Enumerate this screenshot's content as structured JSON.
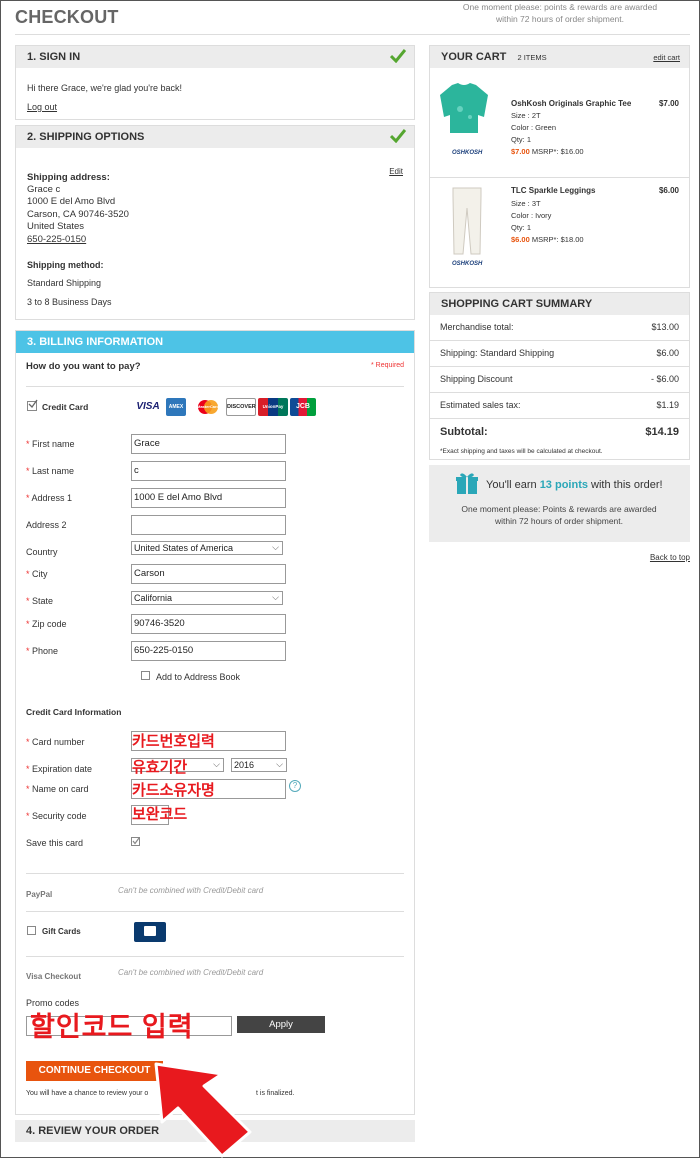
{
  "page": {
    "title": "CHECKOUT",
    "top_note": "One moment please: points & rewards are awarded within 72 hours of order shipment."
  },
  "signin": {
    "heading": "1. SIGN IN",
    "greeting": "Hi there Grace, we're glad you're back!",
    "logout": "Log out"
  },
  "shipping": {
    "heading": "2. SHIPPING OPTIONS",
    "edit": "Edit",
    "address_label": "Shipping address:",
    "name": "Grace c",
    "street": "1000 E del Amo Blvd",
    "city_line": "Carson, CA 90746-3520",
    "country": "United States",
    "phone": "650-225-0150",
    "method_label": "Shipping method:",
    "method": "Standard Shipping",
    "eta": "3 to 8 Business Days"
  },
  "billing": {
    "heading": "3. BILLING INFORMATION",
    "question": "How do you want to pay?",
    "required": "* Required",
    "credit_card_label": "Credit Card",
    "card_logos": [
      "VISA",
      "AMEX",
      "MasterCard",
      "DISCOVER",
      "UnionPay",
      "JCB"
    ],
    "fields": {
      "first_name_label": "First name",
      "first_name_value": "Grace",
      "last_name_label": "Last name",
      "last_name_value": "c",
      "address1_label": "Address 1",
      "address1_value": "1000 E del Amo Blvd",
      "address2_label": "Address 2",
      "address2_value": "",
      "country_label": "Country",
      "country_value": "United States of America",
      "city_label": "City",
      "city_value": "Carson",
      "state_label": "State",
      "state_value": "California",
      "zip_label": "Zip code",
      "zip_value": "90746-3520",
      "phone_label": "Phone",
      "phone_value": "650-225-0150"
    },
    "add_to_address_book": "Add to Address Book",
    "cc_info_heading": "Credit Card Information",
    "card_number_label": "Card number",
    "expiration_label": "Expiration date",
    "expiration_year": "2016",
    "name_on_card_label": "Name on card",
    "security_code_label": "Security code",
    "save_card_label": "Save this card",
    "help_icon": "?",
    "paypal_label": "PayPal",
    "paypal_note": "Can't be combined with Credit/Debit card",
    "gift_cards_label": "Gift Cards",
    "visa_checkout_label": "Visa Checkout",
    "visa_checkout_note": "Can't be combined with Credit/Debit card",
    "promo_label": "Promo codes",
    "apply_label": "Apply",
    "continue_label": "CONTINUE CHECKOUT",
    "footnote": "You will have a chance to review your o",
    "footnote_tail": "t is finalized."
  },
  "annotations": {
    "card_number": "카드번호입력",
    "expiration": "유효기간",
    "name_on_card": "카드소유자명",
    "security_code": "보완코드",
    "promo": "할인코드 입력"
  },
  "review": {
    "heading": "4. REVIEW YOUR ORDER"
  },
  "cart": {
    "heading": "YOUR CART",
    "count": "2 ITEMS",
    "edit": "edit cart",
    "items": [
      {
        "name": "OshKosh Originals Graphic Tee",
        "price": "$7.00",
        "size": "Size : 2T",
        "color": "Color : Green",
        "qty": "Qty: 1",
        "sale": "$7.00",
        "msrp": "MSRP*: $16.00",
        "brand": "OSHKOSH"
      },
      {
        "name": "TLC Sparkle Leggings",
        "price": "$6.00",
        "size": "Size : 3T",
        "color": "Color : Ivory",
        "qty": "Qty: 1",
        "sale": "$6.00",
        "msrp": "MSRP*: $18.00",
        "brand": "OSHKOSH"
      }
    ]
  },
  "summary": {
    "heading": "SHOPPING CART SUMMARY",
    "rows": [
      {
        "label": "Merchandise total:",
        "value": "$13.00"
      },
      {
        "label": "Shipping: Standard Shipping",
        "value": "$6.00"
      },
      {
        "label": "Shipping Discount",
        "value": "- $6.00"
      },
      {
        "label": "Estimated sales tax:",
        "value": "$1.19"
      }
    ],
    "subtotal_label": "Subtotal:",
    "subtotal_value": "$14.19",
    "note": "*Exact shipping and taxes will be calculated at checkout."
  },
  "points": {
    "pre": "You'll earn ",
    "points": "13 points",
    "post": " with this order!",
    "note": "One moment please: Points & rewards are awarded within 72 hours of order shipment."
  },
  "back_to_top": "Back to top",
  "colors": {
    "billing_header": "#4dc3e6",
    "continue_button": "#e8540e",
    "annotation_red": "#e8191e",
    "checkmark": "#55a630"
  }
}
